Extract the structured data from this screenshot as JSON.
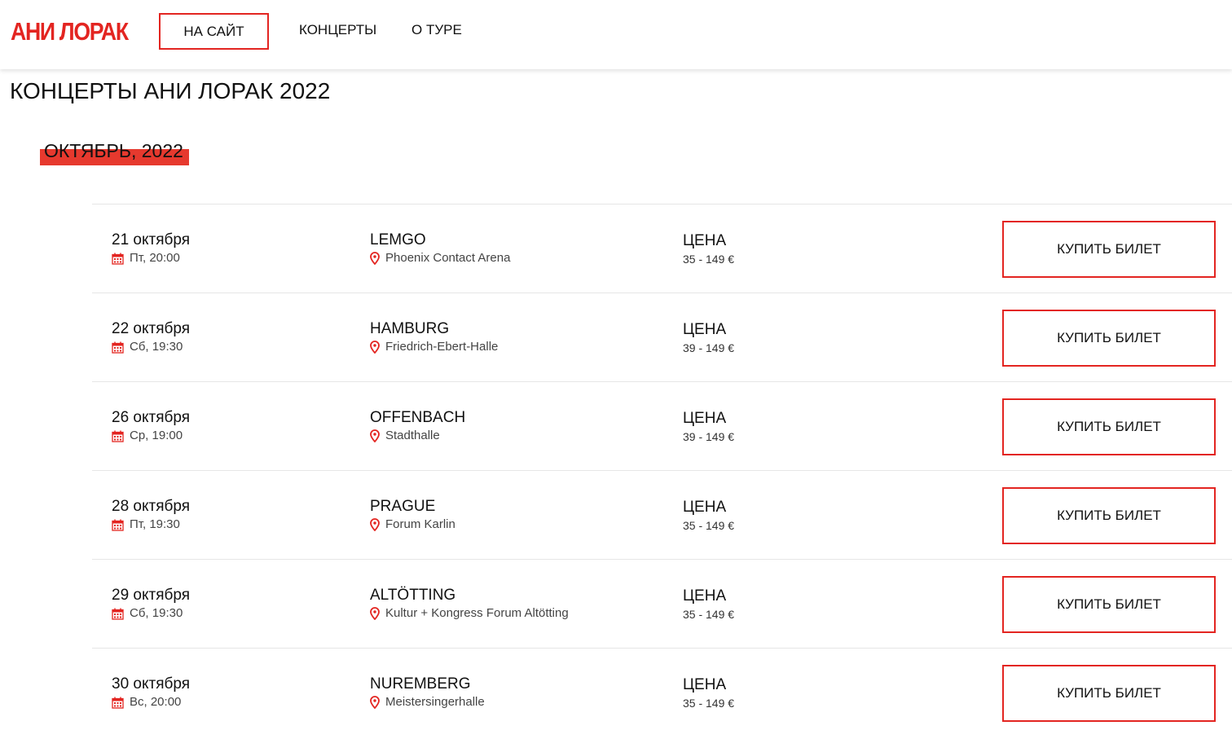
{
  "header": {
    "logo": "АНИ ЛОРАК",
    "nav": {
      "site_button": "НА САЙТ",
      "concerts": "КОНЦЕРТЫ",
      "about": "О ТУРЕ"
    }
  },
  "page": {
    "title": "КОНЦЕРТЫ АНИ ЛОРАК 2022",
    "month": "ОКТЯБРЬ, 2022"
  },
  "colors": {
    "accent": "#e32521",
    "highlight": "#e6392e"
  },
  "concerts": [
    {
      "date": "21 октября",
      "time": "Пт, 20:00",
      "city": "LEMGO",
      "venue": "Phoenix Contact Arena",
      "price_label": "ЦЕНА",
      "price": "35 - 149 €",
      "button": "КУПИТЬ БИЛЕТ"
    },
    {
      "date": "22 октября",
      "time": "Сб, 19:30",
      "city": "HAMBURG",
      "venue": "Friedrich-Ebert-Halle",
      "price_label": "ЦЕНА",
      "price": "39 - 149 €",
      "button": "КУПИТЬ БИЛЕТ"
    },
    {
      "date": "26 октября",
      "time": "Ср, 19:00",
      "city": "OFFENBACH",
      "venue": "Stadthalle",
      "price_label": "ЦЕНА",
      "price": "39 - 149 €",
      "button": "КУПИТЬ БИЛЕТ"
    },
    {
      "date": "28 октября",
      "time": "Пт, 19:30",
      "city": "PRAGUE",
      "venue": "Forum Karlin",
      "price_label": "ЦЕНА",
      "price": "35 - 149 €",
      "button": "КУПИТЬ БИЛЕТ"
    },
    {
      "date": "29 октября",
      "time": "Сб, 19:30",
      "city": "ALTÖTTING",
      "venue": "Kultur + Kongress Forum Altötting",
      "price_label": "ЦЕНА",
      "price": "35 - 149 €",
      "button": "КУПИТЬ БИЛЕТ"
    },
    {
      "date": "30 октября",
      "time": "Вс, 20:00",
      "city": "NUREMBERG",
      "venue": "Meistersingerhalle",
      "price_label": "ЦЕНА",
      "price": "35 - 149 €",
      "button": "КУПИТЬ БИЛЕТ"
    }
  ]
}
